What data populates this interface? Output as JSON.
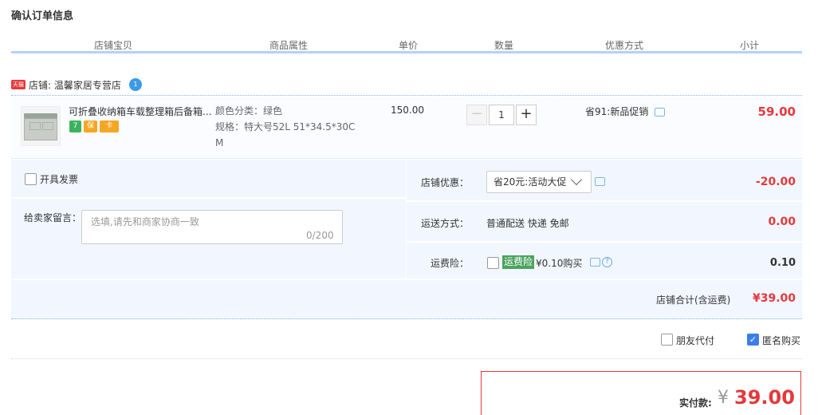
{
  "page": {
    "title": "确认订单信息"
  },
  "columns": [
    "店铺宝贝",
    "商品属性",
    "单价",
    "数量",
    "优惠方式",
    "小计"
  ],
  "shop": {
    "badge": "天猫",
    "label": "店铺: 温馨家居专营店",
    "ww_icon": "1"
  },
  "item": {
    "name": "可折叠收纳箱车载整理箱后备箱...",
    "service_icons": [
      "7",
      "保",
      "卡"
    ],
    "attr_color": "颜色分类：绿色",
    "attr_spec_line1": "规格：特大号52L 51*34.5*30C",
    "attr_spec_line2": "M",
    "unit_price": "150.00",
    "quantity": {
      "minus": "−",
      "value": "1",
      "plus": "+"
    },
    "promo": "省91:新品促销",
    "subtotal": "59.00"
  },
  "invoice": {
    "label": "开具发票",
    "checked": false
  },
  "message": {
    "label": "给卖家留言：",
    "placeholder": "选填,请先和商家协商一致",
    "count": "0/200"
  },
  "shop_discount": {
    "label": "店铺优惠：",
    "selected": "省20元:活动大促",
    "amount": "-20.00"
  },
  "shipping": {
    "label": "运送方式：",
    "value": "普通配送 快递 免邮",
    "amount": "0.00"
  },
  "insurance": {
    "label": "运费险：",
    "badge": "运费险",
    "value": "¥0.10购买",
    "help": "?",
    "amount": "0.10"
  },
  "shop_total": {
    "label": "店铺合计(含运费)",
    "amount": "¥39.00"
  },
  "options": {
    "friend_pay": "朋友代付",
    "anonymous": "匿名购买",
    "anonymous_checked": true
  },
  "final": {
    "label": "实付款:",
    "currency": "¥",
    "amount": "39.00"
  },
  "colors": {
    "accent_red": "#e4393c",
    "header_line": "#b2d1ff",
    "panel_bg": "#f2f7ff",
    "check_blue": "#3d7de8",
    "insurance_green": "#4aa35e"
  }
}
